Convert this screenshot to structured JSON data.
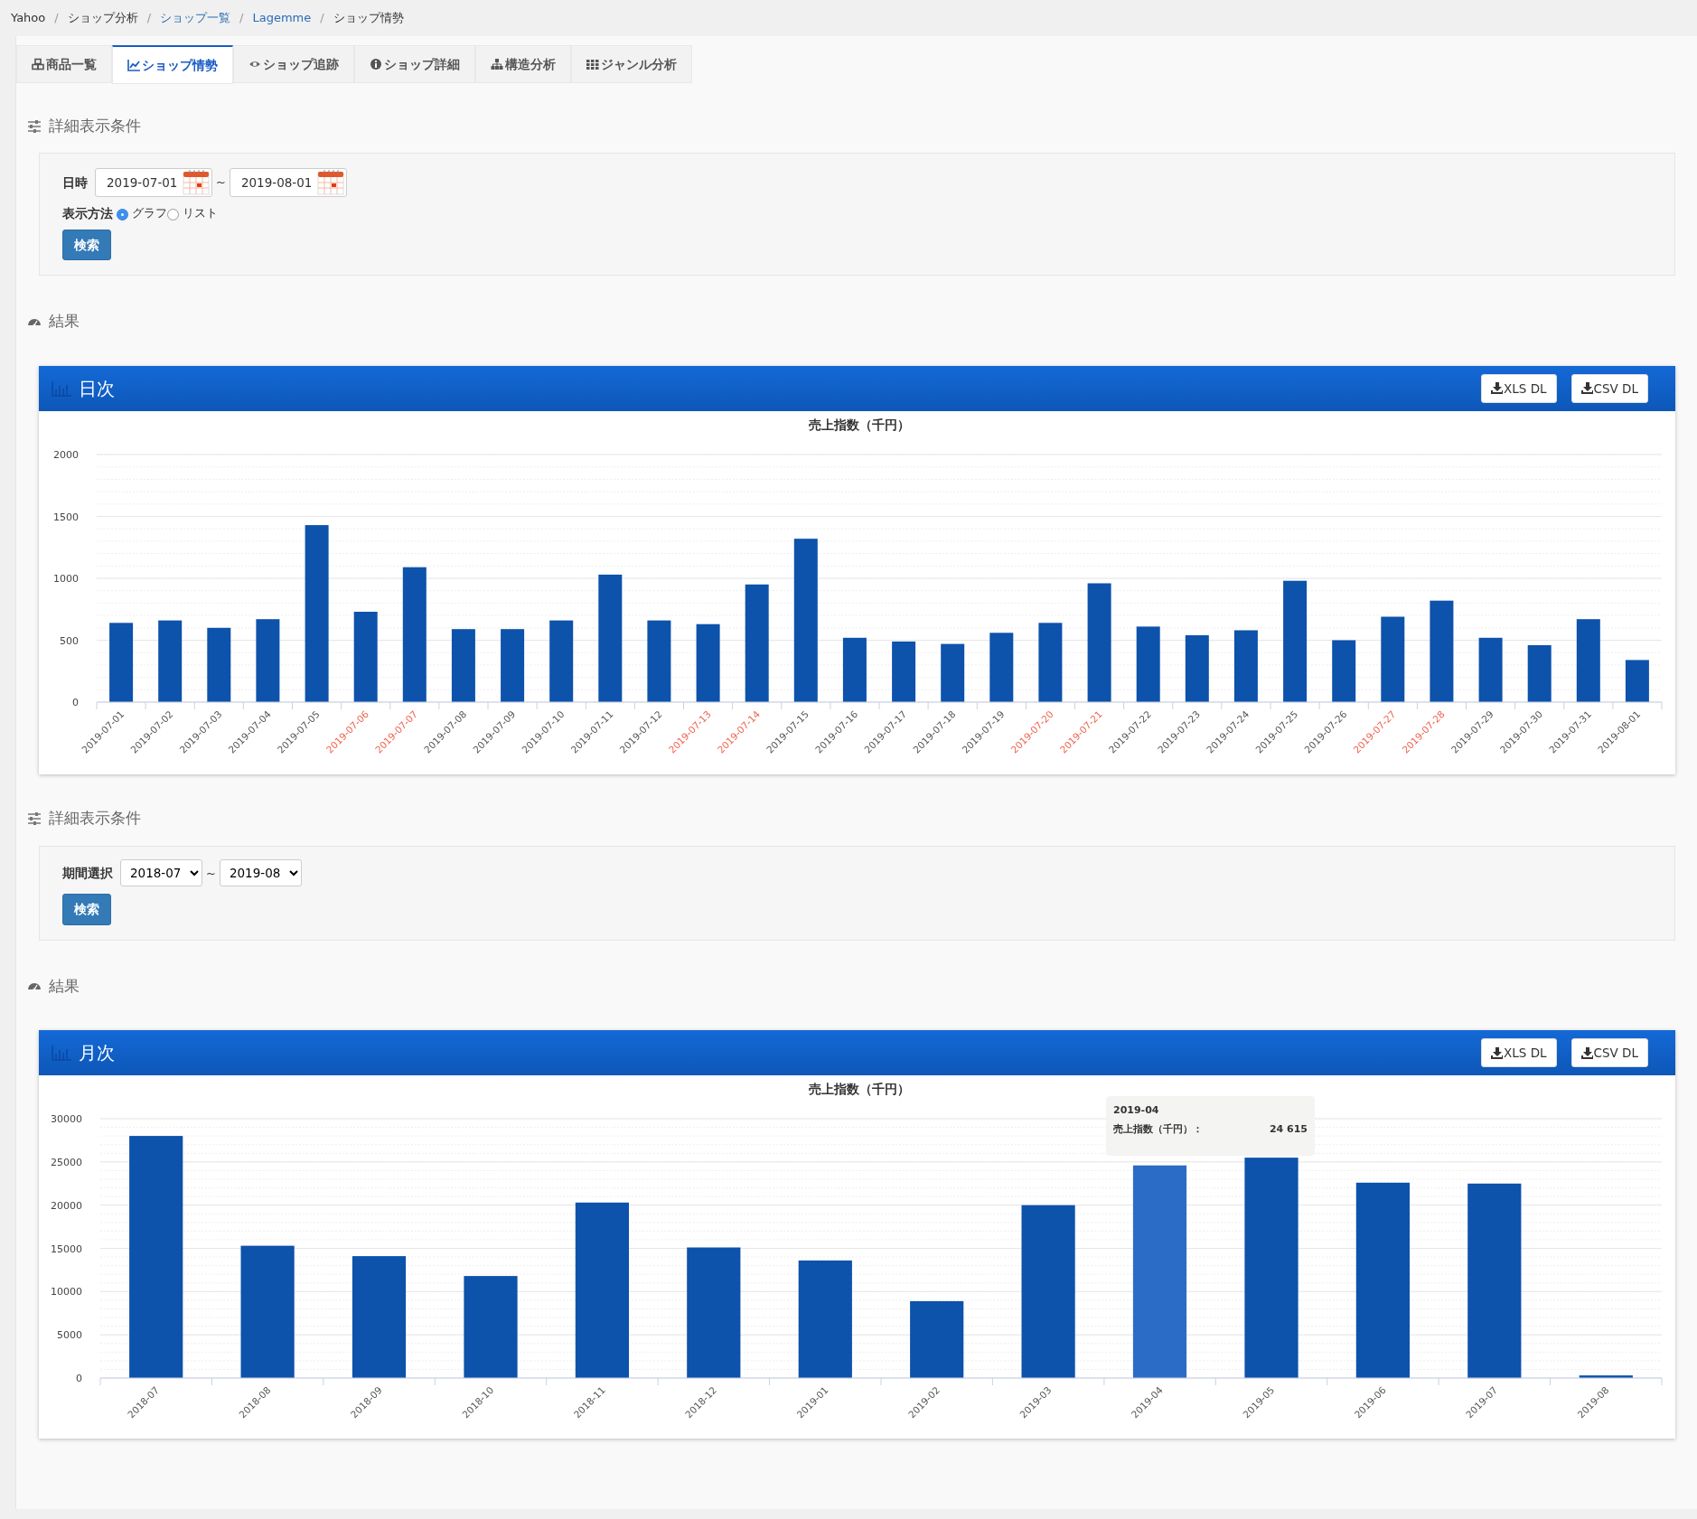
{
  "breadcrumb": [
    {
      "kind": "item",
      "label": "Yahoo",
      "link": false
    },
    {
      "kind": "separator",
      "label": "/"
    },
    {
      "kind": "item",
      "label": "ショップ分析",
      "link": false
    },
    {
      "kind": "separator",
      "label": "/"
    },
    {
      "kind": "item",
      "label": "ショップ一覧",
      "link": true
    },
    {
      "kind": "separator",
      "label": "/"
    },
    {
      "kind": "item",
      "label": "Lagemme",
      "link": true
    },
    {
      "kind": "separator",
      "label": "/"
    },
    {
      "kind": "item",
      "label": "ショップ情勢",
      "link": false
    }
  ],
  "tabs": [
    {
      "label": "商品一覧",
      "selected": false
    },
    {
      "label": "ショップ情勢",
      "selected": true
    },
    {
      "label": "ショップ追跡",
      "selected": false
    },
    {
      "label": "ショップ詳細",
      "selected": false
    },
    {
      "label": "構造分析",
      "selected": false
    },
    {
      "label": "ジャンル分析",
      "selected": false
    }
  ],
  "sections": [
    {
      "kind": "date",
      "conditions_title": "詳細表示条件",
      "field_label": "日時",
      "from": "2019-07-01",
      "separator": "~",
      "to": "2019-08-01",
      "display_label": "表示方法",
      "options": [
        {
          "label": "グラフ",
          "selected": true
        },
        {
          "label": "リスト",
          "selected": false
        }
      ],
      "search_button": "検索",
      "results_title": "結果",
      "card": {
        "title": "日次",
        "buttons": [
          "XLS DL",
          "CSV DL"
        ],
        "holidays": [
          false,
          false,
          false,
          false,
          false,
          true,
          true,
          false,
          false,
          false,
          false,
          false,
          true,
          true,
          false,
          false,
          false,
          false,
          false,
          true,
          true,
          false,
          false,
          false,
          false,
          false,
          true,
          true,
          false,
          false,
          false,
          false
        ],
        "chart_data": {
          "type": "bar",
          "title": "売上指数（千円）",
          "grid": true,
          "categories": [
            "2019-07-01",
            "2019-07-02",
            "2019-07-03",
            "2019-07-04",
            "2019-07-05",
            "2019-07-06",
            "2019-07-07",
            "2019-07-08",
            "2019-07-09",
            "2019-07-10",
            "2019-07-11",
            "2019-07-12",
            "2019-07-13",
            "2019-07-14",
            "2019-07-15",
            "2019-07-16",
            "2019-07-17",
            "2019-07-18",
            "2019-07-19",
            "2019-07-20",
            "2019-07-21",
            "2019-07-22",
            "2019-07-23",
            "2019-07-24",
            "2019-07-25",
            "2019-07-26",
            "2019-07-27",
            "2019-07-28",
            "2019-07-29",
            "2019-07-30",
            "2019-07-31",
            "2019-08-01"
          ],
          "series": [
            {
              "color": "#0d52ab",
              "values": [
                640,
                660,
                600,
                670,
                1430,
                730,
                1090,
                590,
                590,
                660,
                1030,
                660,
                630,
                950,
                1320,
                520,
                490,
                470,
                560,
                640,
                960,
                610,
                540,
                580,
                980,
                500,
                690,
                820,
                520,
                460,
                670,
                340
              ]
            }
          ],
          "ylim": [
            0,
            2000
          ],
          "yticks": [
            0,
            500,
            1000,
            1500,
            2000
          ]
        }
      }
    },
    {
      "kind": "period",
      "conditions_title": "詳細表示条件",
      "field_label": "期間選択",
      "from": "2018-07",
      "separator": "~",
      "to": "2019-08",
      "search_button": "検索",
      "results_title": "結果",
      "card": {
        "title": "月次",
        "buttons": [
          "XLS DL",
          "CSV DL"
        ],
        "chart_data": {
          "type": "bar",
          "title": "売上指数（千円）",
          "grid": true,
          "categories": [
            "2018-07",
            "2018-08",
            "2018-09",
            "2018-10",
            "2018-11",
            "2018-12",
            "2019-01",
            "2019-02",
            "2019-03",
            "2019-04",
            "2019-05",
            "2019-06",
            "2019-07",
            "2019-08"
          ],
          "series": [
            {
              "color": "#0d52ab",
              "values": [
                28000,
                15300,
                14100,
                11800,
                20300,
                15100,
                13600,
                8900,
                20000,
                null,
                25500,
                22600,
                22500,
                300
              ]
            },
            {
              "color": "#2a6cc6",
              "values": [
                null,
                null,
                null,
                null,
                null,
                null,
                null,
                null,
                null,
                24600,
                null,
                null,
                null,
                null
              ]
            }
          ],
          "ylim": [
            0,
            30000
          ],
          "yticks": [
            0,
            5000,
            10000,
            15000,
            20000,
            25000,
            30000
          ]
        }
      },
      "tooltip": {
        "title": "2019-04",
        "label": "売上指数（千円）：",
        "value": "24 615"
      }
    }
  ]
}
